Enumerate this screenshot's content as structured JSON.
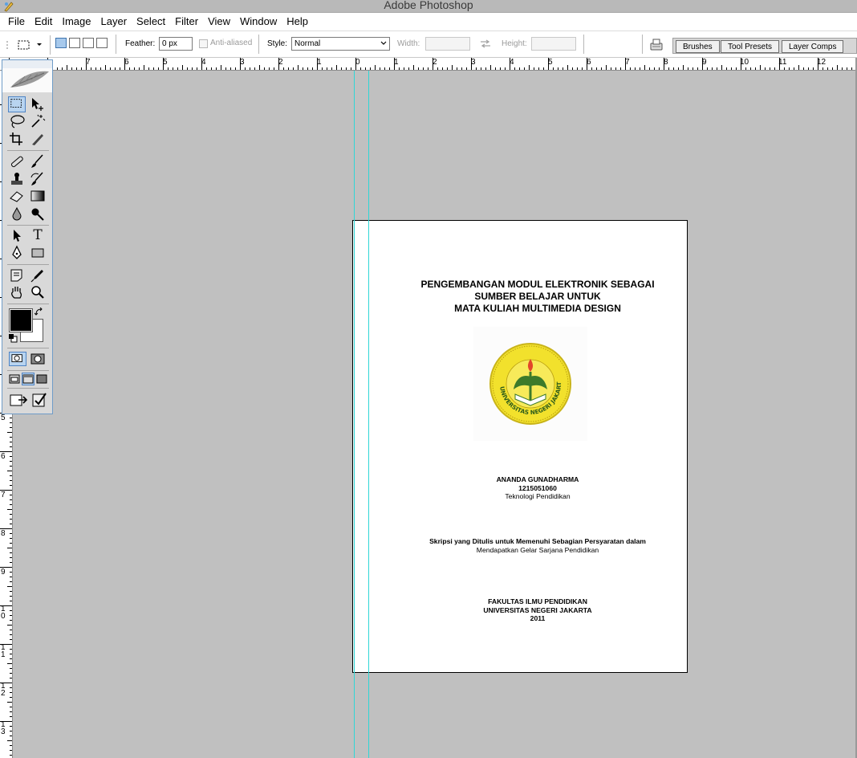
{
  "window": {
    "title": "Adobe Photoshop"
  },
  "menu": [
    "File",
    "Edit",
    "Image",
    "Layer",
    "Select",
    "Filter",
    "View",
    "Window",
    "Help"
  ],
  "options": {
    "feather_label": "Feather:",
    "feather_value": "0 px",
    "antialiased_label": "Anti-aliased",
    "style_label": "Style:",
    "style_value": "Normal",
    "width_label": "Width:",
    "height_label": "Height:"
  },
  "palette_tabs": [
    "Brushes",
    "Tool Presets",
    "Layer Comps"
  ],
  "rulers": {
    "horizontal": [
      "7",
      "6",
      "5",
      "4",
      "3",
      "2",
      "1",
      "0",
      "1",
      "2",
      "3",
      "4",
      "5",
      "6",
      "7",
      "8",
      "9",
      "10",
      "11",
      "12"
    ],
    "vertical": [
      "5",
      "6",
      "7",
      "8",
      "9",
      "10",
      "11",
      "12",
      "13"
    ]
  },
  "document": {
    "title_lines": [
      "PENGEMBANGAN MODUL ELEKTRONIK SEBAGAI",
      "SUMBER BELAJAR UNTUK",
      "MATA KULIAH MULTIMEDIA DESIGN"
    ],
    "author_name": "ANANDA GUNADHARMA",
    "author_id": "1215051060",
    "program": "Teknologi Pendidikan",
    "purpose_lines": [
      "Skripsi yang Ditulis untuk Memenuhi Sebagian Persyaratan dalam",
      "Mendapatkan Gelar Sarjana Pendidikan"
    ],
    "faculty": "FAKULTAS ILMU PENDIDIKAN",
    "university": "UNIVERSITAS NEGERI JAKARTA",
    "year": "2011",
    "logo_text": "UNIVERSITAS NEGERI JAKARTA"
  },
  "toolbox": {
    "tools": [
      "rectangular-marquee",
      "move",
      "lasso",
      "magic-wand",
      "crop",
      "slice",
      "healing-brush",
      "brush",
      "clone-stamp",
      "history-brush",
      "eraser",
      "gradient",
      "blur",
      "dodge",
      "path-selection",
      "type",
      "pen",
      "shape",
      "notes",
      "eyedropper",
      "hand",
      "zoom"
    ],
    "text_tool_glyph": "T"
  },
  "colors": {
    "foreground": "#000000",
    "background": "#ffffff",
    "guide": "#2fd6d6",
    "canvas": "#c0c0c0",
    "logo_yellow": "#f2e12c"
  }
}
